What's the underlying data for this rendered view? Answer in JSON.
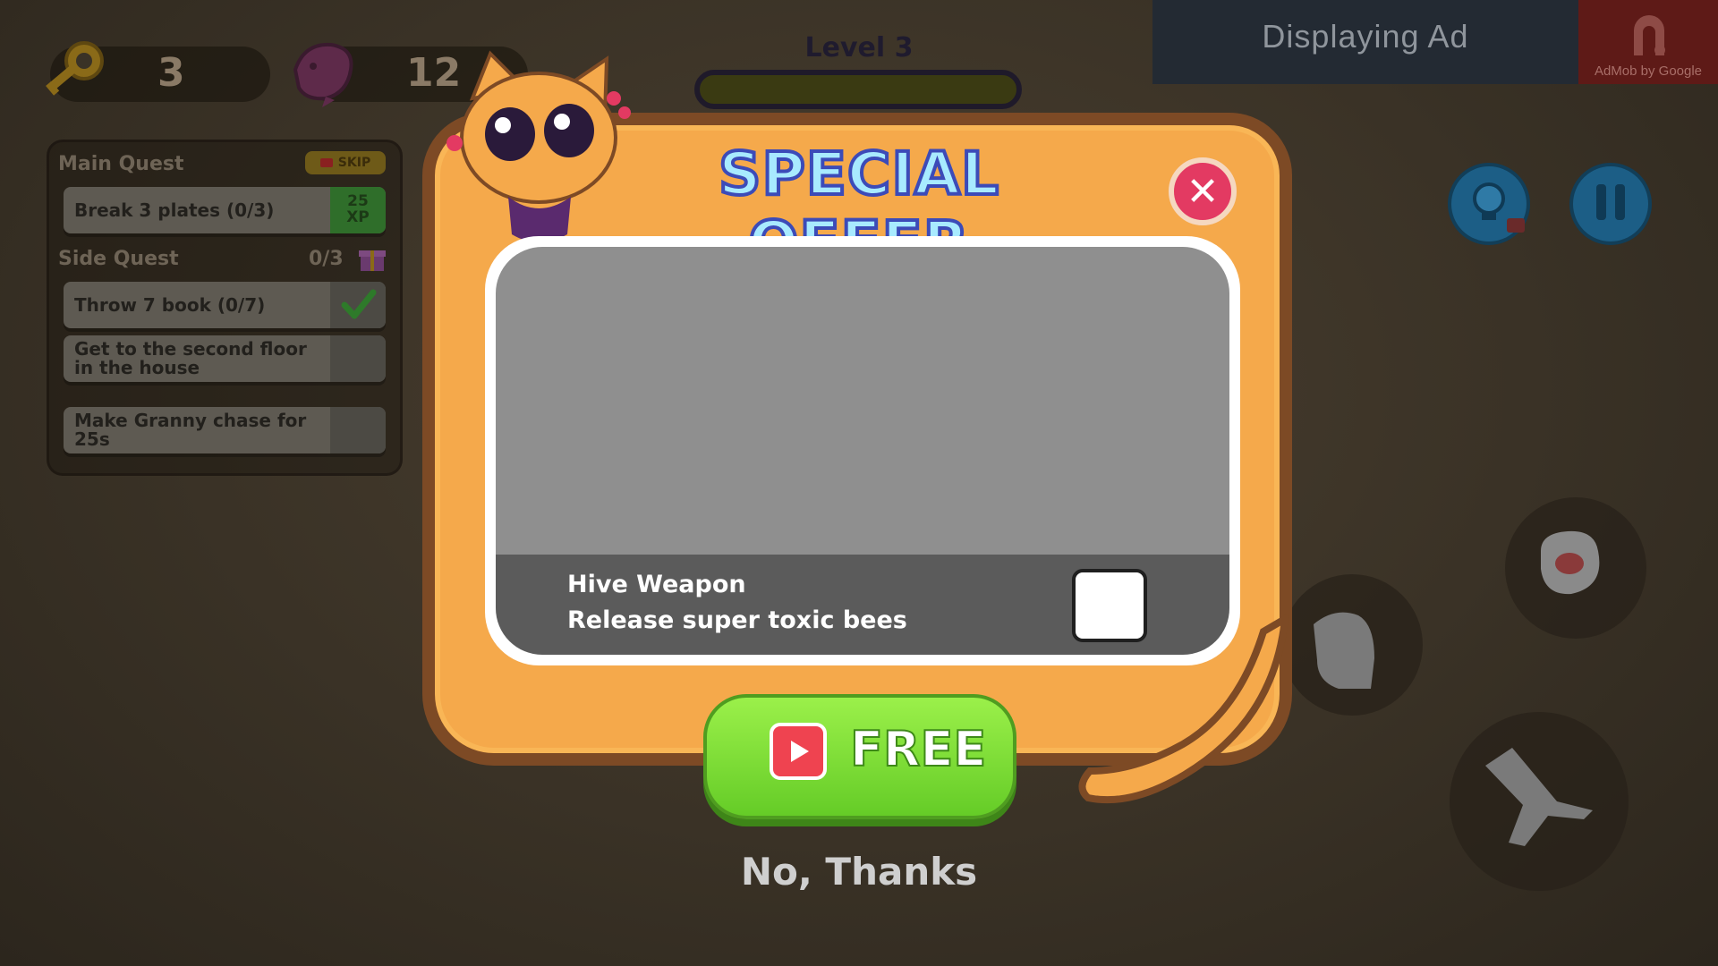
{
  "hud": {
    "keys_count": "3",
    "fish_count": "12",
    "level_label": "Level 3",
    "level_progress": 0.0
  },
  "ad": {
    "text": "Displaying Ad",
    "network": "AdMob by Google"
  },
  "quests": {
    "main_title": "Main Quest",
    "skip_label": "SKIP",
    "main_items": [
      {
        "label": "Break 3 plates (0/3)",
        "reward": "25\nXP"
      }
    ],
    "side_title": "Side Quest",
    "side_progress": "0/3",
    "side_items": [
      {
        "label": "Throw 7 book (0/7)",
        "done": true
      },
      {
        "label": "Get to the second floor in the house",
        "done": false
      },
      {
        "label": "Make Granny chase for 25s",
        "done": false
      }
    ]
  },
  "offer": {
    "title": "SPECIAL OFFER",
    "item_name": "Hive Weapon",
    "item_desc": "Release super toxic bees",
    "free_label": "FREE",
    "decline_label": "No, Thanks"
  },
  "colors": {
    "frame": "#f5a94b",
    "frame_border": "#7d4a25",
    "title_fill": "#a8eaff",
    "title_stroke": "#3c4bb8",
    "close": "#e33a62",
    "free_button": "#7ddc35"
  },
  "icons": {
    "key": "key-icon",
    "fish": "fish-icon",
    "hint": "lightbulb-icon",
    "pause": "pause-icon",
    "close": "close-icon",
    "video": "video-play-icon",
    "gift": "gift-icon",
    "check": "checkmark-icon"
  }
}
